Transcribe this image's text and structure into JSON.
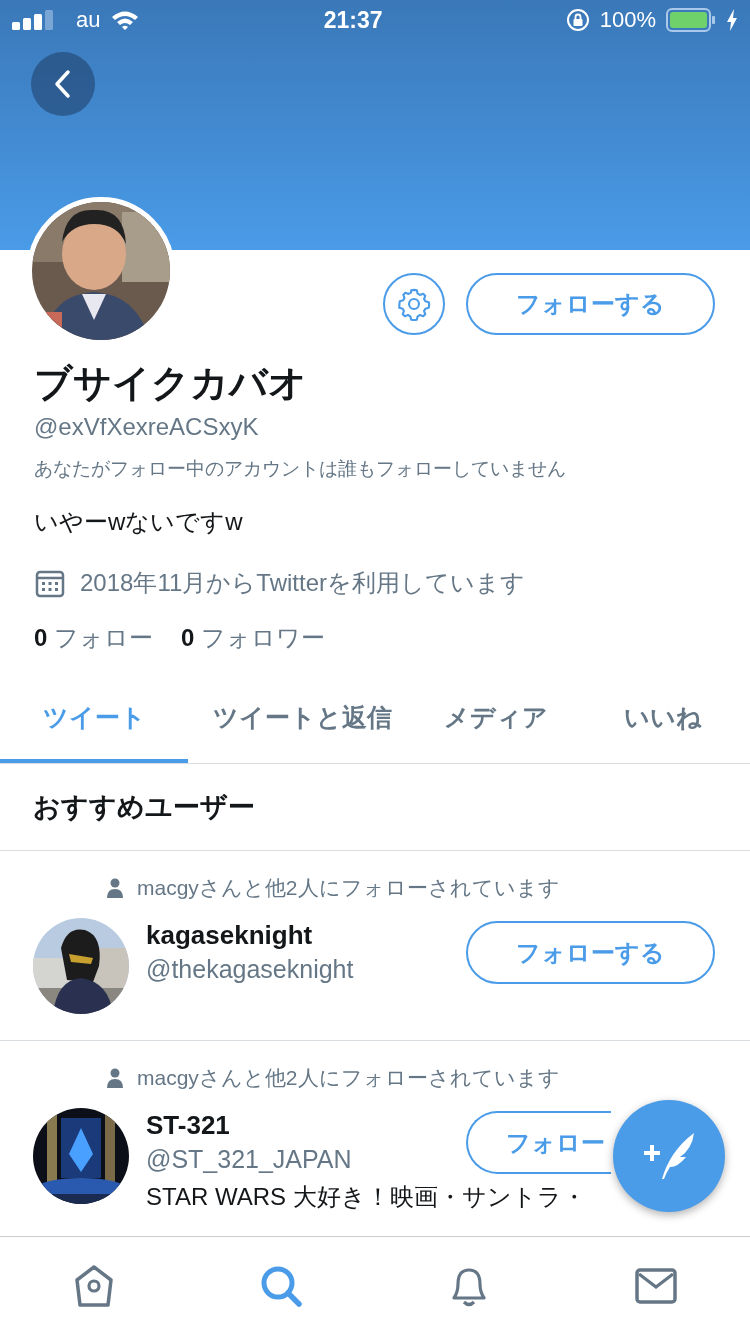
{
  "status_bar": {
    "carrier": "au",
    "time": "21:37",
    "battery": "100%"
  },
  "profile": {
    "name": "ブサイクカバオ",
    "handle": "@exVfXexreACSxyK",
    "follow_note": "あなたがフォロー中のアカウントは誰もフォローしていません",
    "bio": "いやーwないですw",
    "joined": "2018年11月からTwitterを利用しています",
    "following_count": "0",
    "following_label": "フォロー",
    "followers_count": "0",
    "followers_label": "フォロワー",
    "follow_button": "フォローする"
  },
  "tabs": [
    {
      "label": "ツイート",
      "selected": true
    },
    {
      "label": "ツイートと返信",
      "selected": false
    },
    {
      "label": "メディア",
      "selected": false
    },
    {
      "label": "いいね",
      "selected": false
    }
  ],
  "section_title": "おすすめユーザー",
  "suggested_users": [
    {
      "context": "macgyさんと他2人にフォローされています",
      "name": "kagaseknight",
      "handle": "@thekagaseknight",
      "follow_button": "フォローする"
    },
    {
      "context": "macgyさんと他2人にフォローされています",
      "name": "ST-321",
      "handle": "@ST_321_JAPAN",
      "follow_button": "フォロー",
      "bio": "STAR WARS 大好き！映画・サントラ・"
    }
  ],
  "tab_bar": [
    {
      "kind": "home",
      "selected": false
    },
    {
      "kind": "search",
      "selected": true
    },
    {
      "kind": "notifications",
      "selected": false
    },
    {
      "kind": "messages",
      "selected": false
    }
  ]
}
